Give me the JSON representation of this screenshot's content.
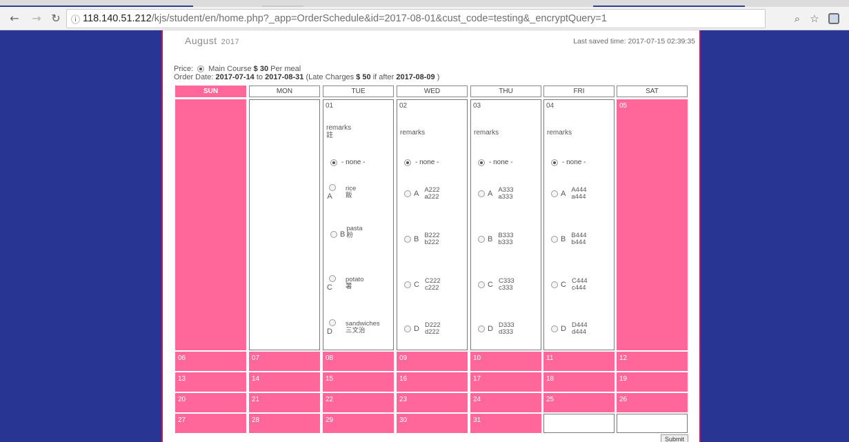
{
  "browser": {
    "back_icon": "arrow-left-icon",
    "forward_icon": "arrow-right-icon",
    "reload_icon": "reload-icon",
    "url_host": "118.140.51.212",
    "url_path": "/kjs/student/en/home.php?_app=OrderSchedule&id=2017-08-01&cust_code=testing&_encryptQuery=1"
  },
  "header": {
    "month": "August",
    "year": "2017",
    "last_saved_label": "Last saved time: 2017-07-15 02:39:35"
  },
  "price": {
    "label": "Price:",
    "course": "Main Course",
    "amount": "$ 30",
    "unit": "Per meal"
  },
  "order": {
    "label": "Order Date:",
    "from": "2017-07-14",
    "to_word": "to",
    "to": "2017-08-31",
    "late_prefix": "(Late Charges",
    "late_amount": "$ 50",
    "late_mid": "if after",
    "late_date": "2017-08-09",
    "late_suffix": ")"
  },
  "weekdays": [
    "SUN",
    "MON",
    "TUE",
    "WED",
    "THU",
    "FRI",
    "SAT"
  ],
  "week1": {
    "tue": {
      "day": "01",
      "remarks": "remarks",
      "remarks_cn": "註",
      "none": "- none -",
      "options": [
        {
          "letter": "A",
          "line1": "rice",
          "line2": "飯"
        },
        {
          "letter": "B",
          "line1": "pasta",
          "line2": "粉"
        },
        {
          "letter": "C",
          "line1": "potato",
          "line2": "薯"
        },
        {
          "letter": "D",
          "line1": "sandwiches",
          "line2": "三文治"
        }
      ]
    },
    "wed": {
      "day": "02",
      "remarks": "remarks",
      "none": "- none -",
      "options": [
        {
          "letter": "A",
          "line1": "A222",
          "line2": "a222"
        },
        {
          "letter": "B",
          "line1": "B222",
          "line2": "b222"
        },
        {
          "letter": "C",
          "line1": "C222",
          "line2": "c222"
        },
        {
          "letter": "D",
          "line1": "D222",
          "line2": "d222"
        }
      ]
    },
    "thu": {
      "day": "03",
      "remarks": "remarks",
      "none": "- none -",
      "options": [
        {
          "letter": "A",
          "line1": "A333",
          "line2": "a333"
        },
        {
          "letter": "B",
          "line1": "B333",
          "line2": "b333"
        },
        {
          "letter": "C",
          "line1": "C333",
          "line2": "c333"
        },
        {
          "letter": "D",
          "line1": "D333",
          "line2": "d333"
        }
      ]
    },
    "fri": {
      "day": "04",
      "remarks": "remarks",
      "none": "- none -",
      "options": [
        {
          "letter": "A",
          "line1": "A444",
          "line2": "a444"
        },
        {
          "letter": "B",
          "line1": "B444",
          "line2": "b444"
        },
        {
          "letter": "C",
          "line1": "C444",
          "line2": "c444"
        },
        {
          "letter": "D",
          "line1": "D444",
          "line2": "d444"
        }
      ]
    },
    "sat": {
      "day": "05"
    }
  },
  "weeks_rest": [
    [
      "06",
      "07",
      "08",
      "09",
      "10",
      "11",
      "12"
    ],
    [
      "13",
      "14",
      "15",
      "16",
      "17",
      "18",
      "19"
    ],
    [
      "20",
      "21",
      "22",
      "23",
      "24",
      "25",
      "26"
    ],
    [
      "27",
      "28",
      "29",
      "30",
      "31",
      "",
      ""
    ]
  ],
  "submit_label": "Submit",
  "colors": {
    "page_bg": "#283593",
    "pink": "#ff6699",
    "border_accent": "#c2185b"
  }
}
